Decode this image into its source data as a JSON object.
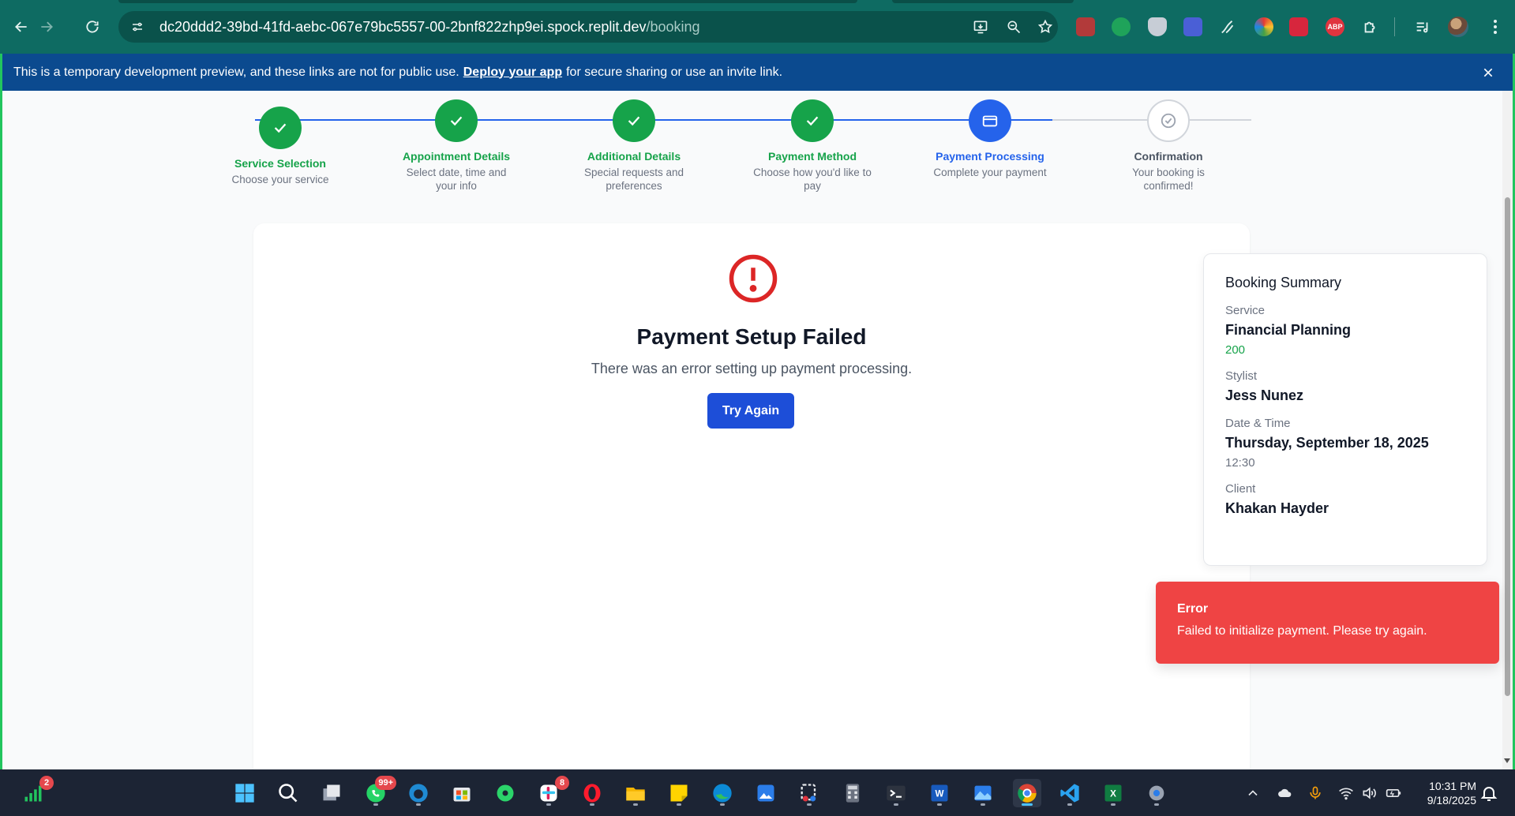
{
  "browser": {
    "url_host": "dc20ddd2-39bd-41fd-aebc-067e79bc5557-00-2bnf822zhp9ei.spock.replit.dev",
    "url_path": "/booking"
  },
  "banner": {
    "text_before": "This is a temporary development preview, and these links are not for public use.",
    "link_label": "Deploy your app",
    "text_after": "for secure sharing or use an invite link."
  },
  "steps": [
    {
      "title": "Service Selection",
      "desc": "Choose your service",
      "state": "complete"
    },
    {
      "title": "Appointment Details",
      "desc": "Select date, time and your info",
      "state": "complete"
    },
    {
      "title": "Additional Details",
      "desc": "Special requests and preferences",
      "state": "complete"
    },
    {
      "title": "Payment Method",
      "desc": "Choose how you'd like to pay",
      "state": "complete"
    },
    {
      "title": "Payment Processing",
      "desc": "Complete your payment",
      "state": "current"
    },
    {
      "title": "Confirmation",
      "desc": "Your booking is confirmed!",
      "state": "pending"
    }
  ],
  "error_panel": {
    "title": "Payment Setup Failed",
    "message": "There was an error setting up payment processing.",
    "retry_label": "Try Again"
  },
  "summary": {
    "heading": "Booking Summary",
    "service_label": "Service",
    "service_value": "Financial Planning",
    "service_price": "200",
    "stylist_label": "Stylist",
    "stylist_value": "Jess Nunez",
    "datetime_label": "Date & Time",
    "date_value": "Thursday, September 18, 2025",
    "time_value": "12:30",
    "client_label": "Client",
    "client_value": "Khakan Hayder"
  },
  "toast": {
    "title": "Error",
    "message": "Failed to initialize payment. Please try again."
  },
  "taskbar": {
    "signal_badge": "2",
    "whatsapp_badge": "99+",
    "slack_badge": "8",
    "time": "10:31 PM",
    "date": "9/18/2025"
  },
  "colors": {
    "accent_blue": "#2563eb",
    "success_green": "#16a34a",
    "error_red": "#ef4444",
    "banner_blue": "#0b4a8f"
  }
}
